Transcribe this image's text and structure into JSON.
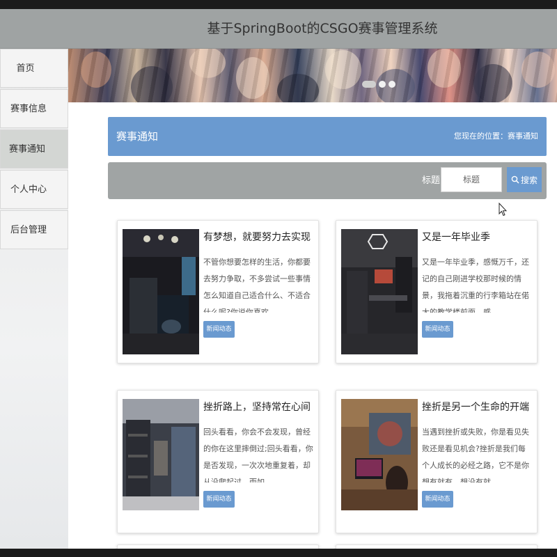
{
  "app": {
    "title": "基于SpringBoot的CSGO赛事管理系统"
  },
  "sidebar": {
    "items": [
      {
        "label": "首页"
      },
      {
        "label": "赛事信息"
      },
      {
        "label": "赛事通知",
        "active": true
      },
      {
        "label": "个人中心"
      },
      {
        "label": "后台管理"
      }
    ]
  },
  "banner": {
    "active_slide": 1,
    "slide_count": 3
  },
  "section": {
    "title": "赛事通知",
    "breadcrumb": "您现在的位置：赛事通知"
  },
  "search": {
    "label": "标题",
    "placeholder": "标题",
    "button_label": "搜索",
    "button_icon": "search-icon"
  },
  "cards": [
    {
      "title": "有梦想，就要努力去实现",
      "excerpt": "不管你想要怎样的生活，你都要去努力争取，不多尝试一些事情怎么知道自己适合什么、不适合什么呢?你说你喜欢...",
      "tag": "新闻动态"
    },
    {
      "title": "又是一年毕业季",
      "excerpt": "又是一年毕业季，感慨万千，还记的自己刚进学校那时候的情景，我拖着沉重的行李箱站在偌大的教学楼前面，感...",
      "tag": "新闻动态"
    },
    {
      "title": "挫折路上，坚持常在心间",
      "excerpt": "回头看看，你会不会发现，曾经的你在这里摔倒过;回头看看，你是否发现，一次次地重复着，却从没爬起过。而如...",
      "tag": "新闻动态"
    },
    {
      "title": "挫折是另一个生命的开端",
      "excerpt": "当遇到挫折或失败，你是看见失败还是看见机会?挫折是我们每个人成长的必经之路，它不是你想有就有，想没有就...",
      "tag": "新闻动态"
    }
  ],
  "colors": {
    "accent": "#6a9ad0",
    "header": "#9fa3a3",
    "search_bar": "#a0a4a4"
  }
}
